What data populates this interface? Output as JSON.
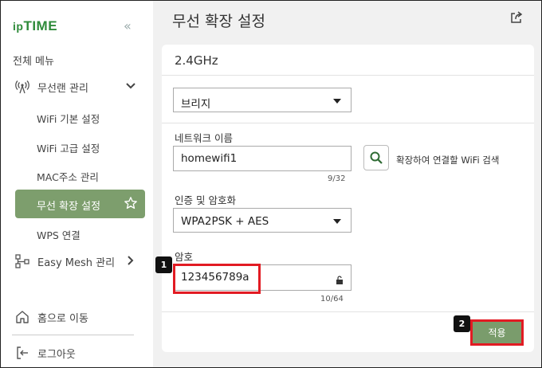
{
  "sidebar": {
    "logo_ip": "ip",
    "logo_time": "TIME",
    "collapse_glyph": "«",
    "menu_title": "전체 메뉴",
    "wireless_lan": "무선랜 관리",
    "sub_items": [
      "WiFi 기본 설정",
      "WiFi 고급 설정",
      "MAC주소 관리",
      "무선 확장 설정",
      "WPS 연결"
    ],
    "active_item": "무선 확장 설정",
    "easy_mesh": "Easy Mesh 관리",
    "home": "홈으로 이동",
    "logout": "로그아웃"
  },
  "main": {
    "page_title": "무선 확장 설정",
    "card_title": "2.4GHz",
    "mode_select": "브리지",
    "network_name_label": "네트워크 이름",
    "network_name_value": "homewifi1",
    "network_name_counter": "9/32",
    "search_label": "확장하여 연결할 WiFi 검색",
    "auth_label": "인증 및 암호화",
    "auth_select": "WPA2PSK + AES",
    "password_label": "암호",
    "password_value": "123456789a",
    "password_counter": "10/64",
    "apply_label": "적용"
  },
  "annotations": {
    "step1": "1",
    "step2": "2"
  },
  "colors": {
    "brand_green": "#2e8b3a",
    "active_bg": "#7d9e6d",
    "apply_bg": "#7a9c6c",
    "highlight_red": "#e21b23"
  },
  "icons": [
    "double-chevron-left-icon",
    "antenna-icon",
    "chevron-down-icon",
    "star-icon",
    "mesh-icon",
    "chevron-right-icon",
    "home-icon",
    "logout-icon",
    "export-icon",
    "search-icon",
    "lock-icon"
  ]
}
